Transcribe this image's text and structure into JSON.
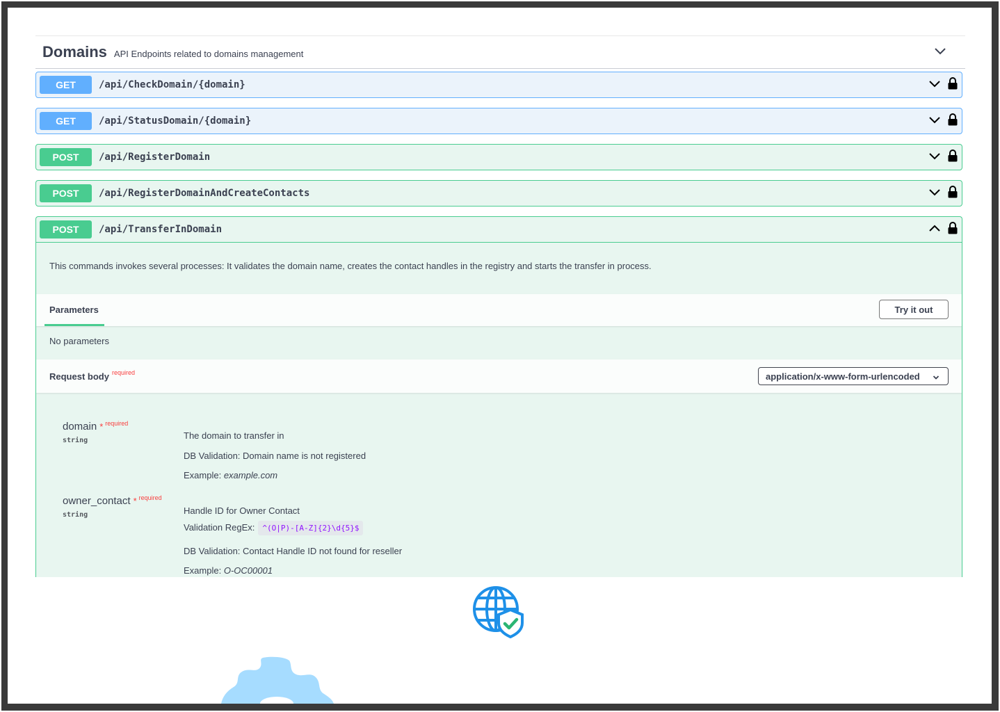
{
  "tag": {
    "name": "Domains",
    "description": "API Endpoints related to domains management"
  },
  "operations": [
    {
      "method": "GET",
      "path": "/api/CheckDomain/{domain}"
    },
    {
      "method": "GET",
      "path": "/api/StatusDomain/{domain}"
    },
    {
      "method": "POST",
      "path": "/api/RegisterDomain"
    },
    {
      "method": "POST",
      "path": "/api/RegisterDomainAndCreateContacts"
    },
    {
      "method": "POST",
      "path": "/api/TransferInDomain"
    }
  ],
  "expanded": {
    "description": "This commands invokes several processes: It validates the domain name, creates the contact handles in the registry and starts the transfer in process.",
    "parameters_tab": "Parameters",
    "try_it_out": "Try it out",
    "no_parameters": "No parameters",
    "request_body_label": "Request body",
    "required_label": "required",
    "content_type": "application/x-www-form-urlencoded",
    "properties": [
      {
        "name": "domain",
        "star": "*",
        "required": "required",
        "type": "string",
        "lines": {
          "desc": "The domain to transfer in",
          "db_validation": "DB Validation: Domain name is not registered",
          "example_label": "Example:",
          "example_value": "example.com"
        }
      },
      {
        "name": "owner_contact",
        "star": "*",
        "required": "required",
        "type": "string",
        "lines": {
          "desc": "Handle ID for Owner Contact",
          "regex_label": "Validation RegEx:",
          "regex_value": "^(O|P)-[A-Z]{2}\\d{5}$",
          "db_validation": "DB Validation: Contact Handle ID not found for reseller",
          "example_label": "Example:",
          "example_value": "O-OC00001"
        }
      }
    ]
  },
  "colors": {
    "get": "#61affe",
    "post": "#49cc90",
    "required": "#f93e3e",
    "regex": "#9012fe",
    "globe": "#1e90e8",
    "shield": "#2bb573",
    "gear": "#a6dcff"
  },
  "icons": [
    "chevron-down-icon",
    "chevron-up-icon",
    "lock-icon",
    "globe-shield-icon",
    "gear-icon"
  ]
}
